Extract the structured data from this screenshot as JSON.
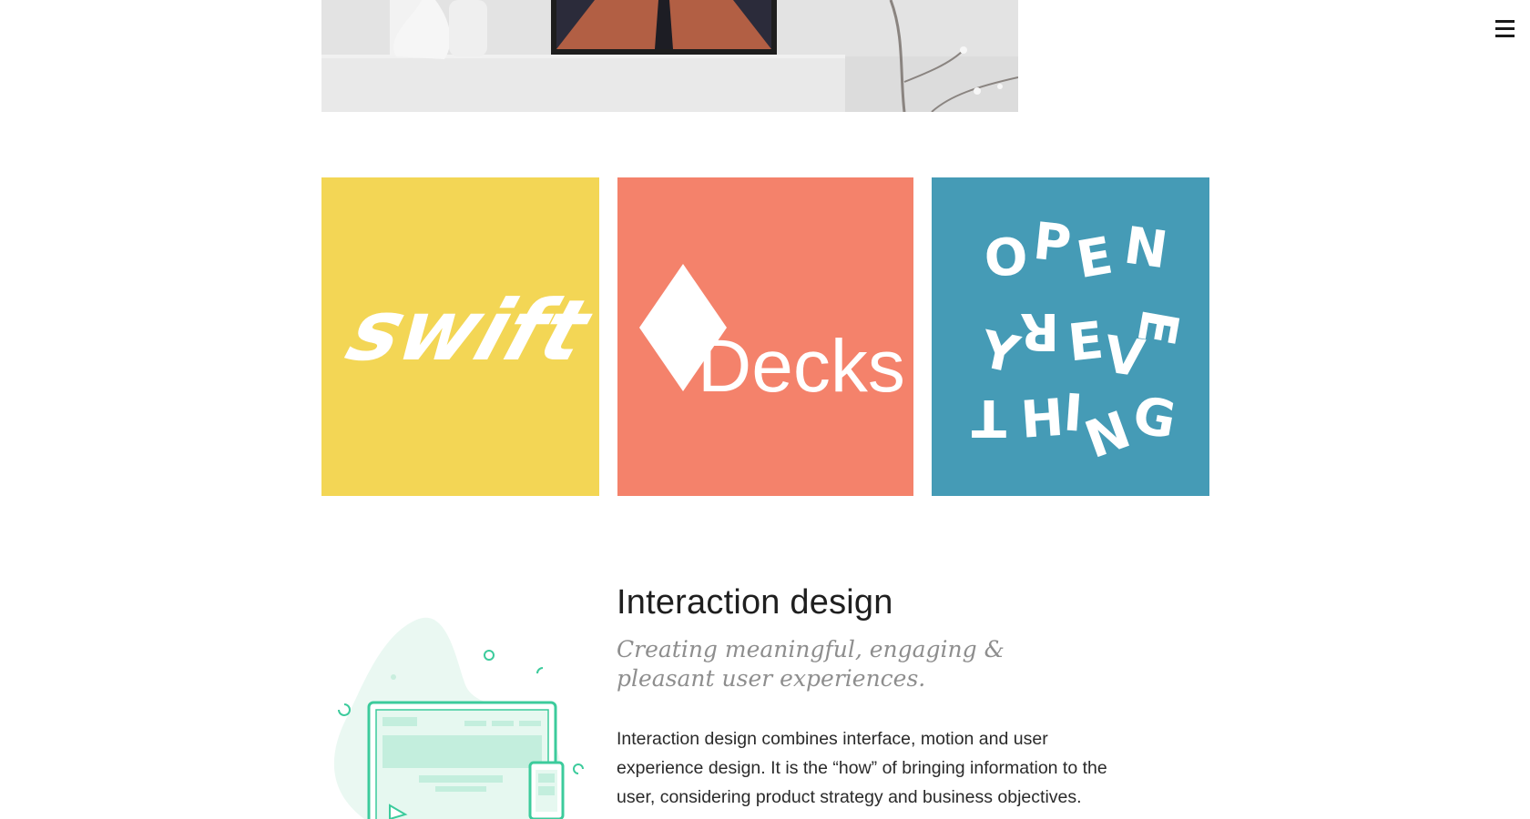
{
  "header": {
    "menu_icon": "hamburger-icon"
  },
  "hero": {
    "description_icon": "room-mockup-image"
  },
  "projects": [
    {
      "id": "swift",
      "logo_text": "swift",
      "bg_color": "#F3D655"
    },
    {
      "id": "decks",
      "logo_text": "Decks",
      "bg_color": "#F4826B"
    },
    {
      "id": "open-everything",
      "logo_text": "OPEN EVERYTHING",
      "bg_color": "#459BB6"
    }
  ],
  "interaction": {
    "title": "Interaction design",
    "subtitle": "Creating meaningful, engaging & pleasant user experiences.",
    "body": "Interaction design combines interface, motion and user experience design. It is the “how” of bringing information to the user, considering product strategy and business objectives.",
    "illustration_icon": "devices-illustration",
    "accent_color": "#3CCB9C"
  }
}
